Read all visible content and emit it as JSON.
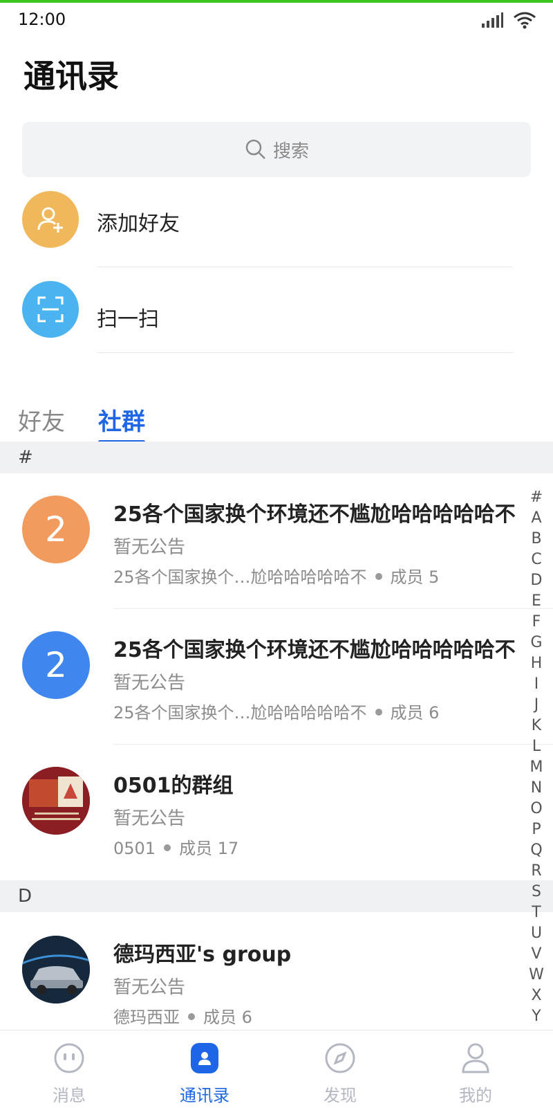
{
  "status": {
    "time": "12:00"
  },
  "page": {
    "title": "通讯录"
  },
  "search": {
    "placeholder": "搜索"
  },
  "actions": [
    {
      "label": "添加好友",
      "icon": "add-user-icon",
      "color": "#f0b85a"
    },
    {
      "label": "扫一扫",
      "icon": "scan-icon",
      "color": "#4ab3f0"
    }
  ],
  "tabs": [
    {
      "label": "好友",
      "active": false
    },
    {
      "label": "社群",
      "active": true
    }
  ],
  "sections": [
    {
      "header": "#",
      "groups": [
        {
          "avatar_text": "2",
          "avatar_color": "#f29b5f",
          "name": "25各个国家换个环境还不尴尬哈哈哈哈哈不",
          "notice": "暂无公告",
          "owner": "25各个国家换个…尬哈哈哈哈哈不",
          "members": "成员 5"
        },
        {
          "avatar_text": "2",
          "avatar_color": "#3f86ee",
          "name": "25各个国家换个环境还不尴尬哈哈哈哈哈不",
          "notice": "暂无公告",
          "owner": "25各个国家换个…尬哈哈哈哈哈不",
          "members": "成员 6"
        },
        {
          "avatar_text": "",
          "avatar_color": "#8b1e22",
          "name": "0501的群组",
          "notice": "暂无公告",
          "owner": "0501",
          "members": "成员 17"
        }
      ]
    },
    {
      "header": "D",
      "groups": [
        {
          "avatar_text": "",
          "avatar_color": "#1f3a55",
          "name": "德玛西亚's group",
          "notice": "暂无公告",
          "owner": "德玛西亚",
          "members": "成员 6"
        }
      ]
    }
  ],
  "index_letters": [
    "#",
    "A",
    "B",
    "C",
    "D",
    "E",
    "F",
    "G",
    "H",
    "I",
    "J",
    "K",
    "L",
    "M",
    "N",
    "O",
    "P",
    "Q",
    "R",
    "S",
    "T",
    "U",
    "V",
    "W",
    "X",
    "Y"
  ],
  "bottom_nav": [
    {
      "label": "消息",
      "icon": "message-icon",
      "active": false
    },
    {
      "label": "通讯录",
      "icon": "contacts-icon",
      "active": true
    },
    {
      "label": "发现",
      "icon": "compass-icon",
      "active": false
    },
    {
      "label": "我的",
      "icon": "profile-icon",
      "active": false
    }
  ],
  "colors": {
    "accent": "#1e66e6",
    "status_bar": "#3cc51f"
  }
}
